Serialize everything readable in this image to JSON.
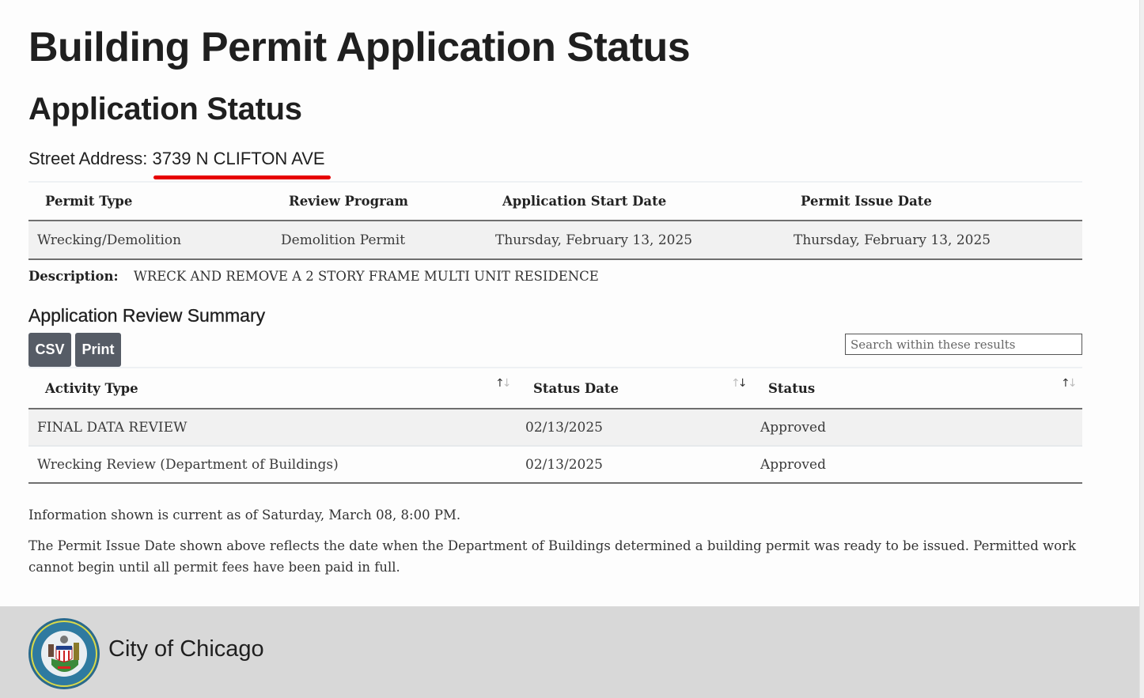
{
  "page": {
    "title": "Building Permit Application Status",
    "subtitle": "Application Status",
    "address_label": "Street Address:",
    "address_value": "3739 N CLIFTON AVE",
    "annotation_color": "#e60000"
  },
  "permit_table": {
    "headers": [
      "Permit Type",
      "Review Program",
      "Application Start Date",
      "Permit Issue Date"
    ],
    "rows": [
      [
        "Wrecking/Demolition",
        "Demolition Permit",
        "Thursday, February 13, 2025",
        "Thursday, February 13, 2025"
      ]
    ]
  },
  "description": {
    "label": "Description:",
    "value": "WRECK AND REMOVE A 2 STORY FRAME MULTI UNIT RESIDENCE"
  },
  "review_summary": {
    "title": "Application Review Summary",
    "csv_label": "CSV",
    "print_label": "Print",
    "search_placeholder": "Search within these results",
    "search_value": "",
    "headers": [
      "Activity Type",
      "Status Date",
      "Status"
    ],
    "sort_icons": [
      "sort-up-down-icon",
      "sort-up-down-icon",
      "sort-up-down-icon"
    ],
    "rows": [
      [
        "FINAL DATA REVIEW",
        "02/13/2025",
        "Approved"
      ],
      [
        "Wrecking Review (Department of Buildings)",
        "02/13/2025",
        "Approved"
      ]
    ]
  },
  "notes": {
    "current_as_of": "Information shown is current as of Saturday, March 08, 8:00 PM.",
    "disclaimer": "The Permit Issue Date shown above reflects the date when the Department of Buildings determined a building permit was ready to be issued. Permitted work cannot begin until all permit fees have been paid in full."
  },
  "footer": {
    "seal_icon": "city-seal-icon",
    "title": "City of Chicago"
  },
  "colors": {
    "button_bg": "#565c66",
    "footer_bg": "#d8d8d8",
    "row_stripe": "#f1f1f1"
  }
}
